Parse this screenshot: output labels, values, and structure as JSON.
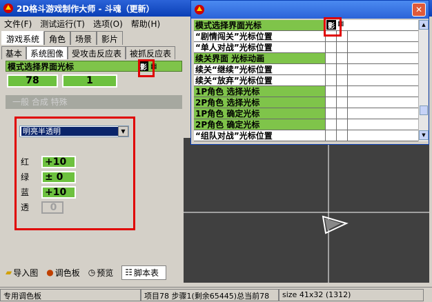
{
  "window": {
    "title": "2D格斗游戏制作大师 - 斗魂（更新）"
  },
  "menu": [
    "文件(F)",
    "测试运行(T)",
    "选项(O)",
    "帮助(H)"
  ],
  "tabs_top": [
    "游戏系统",
    "角色",
    "场景",
    "影片"
  ],
  "tabs_sub": [
    "基本",
    "系统图像",
    "受攻击反应表",
    "被抓反应表"
  ],
  "left_panel": {
    "green_label": "模式选择界面光标",
    "cap_label": "影",
    "num_left": "78",
    "num_right": "1",
    "section": "一般 合成 特殊",
    "select_value": "明亮半透明",
    "rgb": [
      {
        "label": "红",
        "value": "+10"
      },
      {
        "label": "绿",
        "value": "± 0"
      },
      {
        "label": "蓝",
        "value": "+10"
      },
      {
        "label": "透",
        "value": "0"
      }
    ]
  },
  "bottom_tabs": [
    "导入图",
    "调色板",
    "预览",
    "脚本表"
  ],
  "status": {
    "left": "专用调色板",
    "mid": "项目78 步骤1(剩余65445)总当前78",
    "right": "size 41x32 (1312)"
  },
  "float": {
    "rows": [
      {
        "label": "模式选择界面光标",
        "green": true
      },
      {
        "label": "“剧情闯关”光标位置",
        "green": false
      },
      {
        "label": "“单人对战”光标位置",
        "green": false
      },
      {
        "label": "续关界面 光标动画",
        "green": true
      },
      {
        "label": "续关“继续”光标位置",
        "green": false
      },
      {
        "label": "续关“放弃”光标位置",
        "green": false
      },
      {
        "label": "1P角色 选择光标",
        "green": true
      },
      {
        "label": "2P角色 选择光标",
        "green": true
      },
      {
        "label": "1P角色 确定光标",
        "green": true
      },
      {
        "label": "2P角色 确定光标",
        "green": true
      },
      {
        "label": "“组队对战”光标位置",
        "green": false
      }
    ]
  },
  "colors": {
    "accent": "#e00000",
    "green": "#7fc44a"
  }
}
